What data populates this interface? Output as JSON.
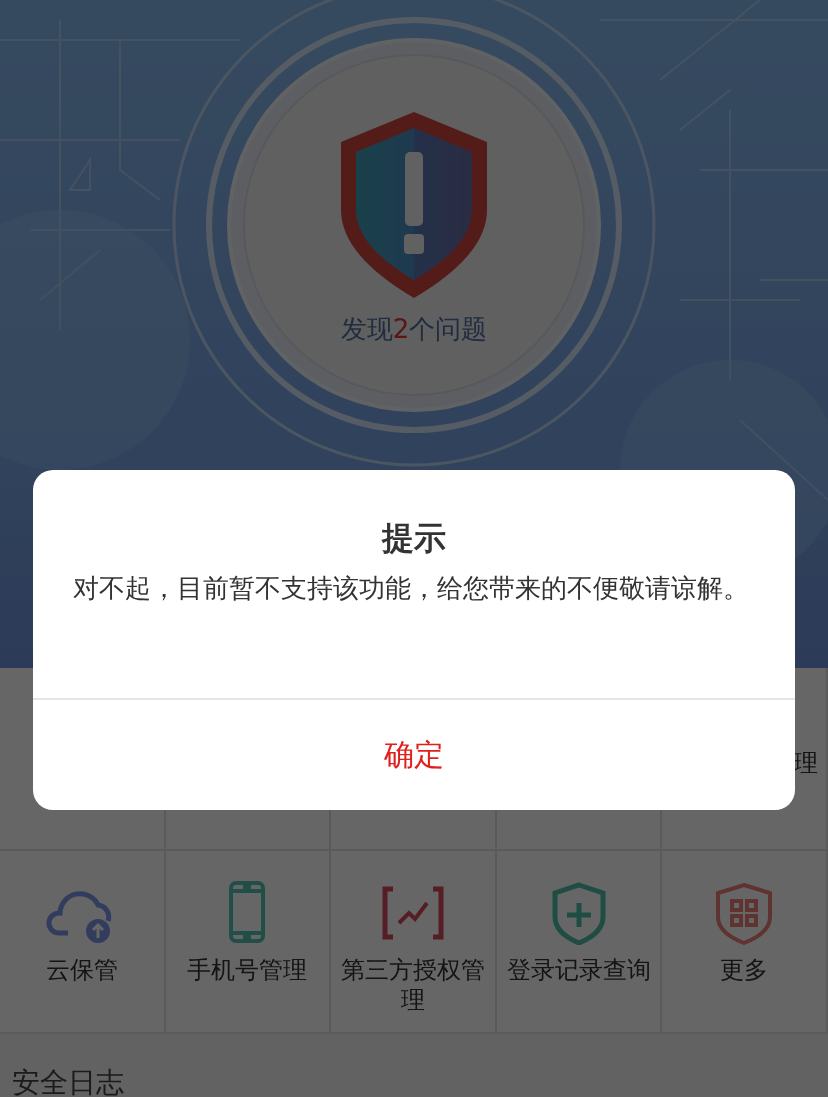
{
  "scan": {
    "result_prefix": "发现",
    "issue_count": "2",
    "result_suffix": "个问题"
  },
  "grid": {
    "partial_row_text": "理",
    "items": [
      {
        "kind": "cloud",
        "label": "云保管"
      },
      {
        "kind": "phone",
        "label": "手机号管理"
      },
      {
        "kind": "chart",
        "label": "第三方授权管理"
      },
      {
        "kind": "shield-plus",
        "label": "登录记录查询"
      },
      {
        "kind": "more",
        "label": "更多"
      }
    ]
  },
  "section_title": "安全日志",
  "dialog": {
    "title": "提示",
    "message": "对不起，目前暂不支持该功能，给您带来的不便敬请谅解。",
    "button": "确定"
  }
}
